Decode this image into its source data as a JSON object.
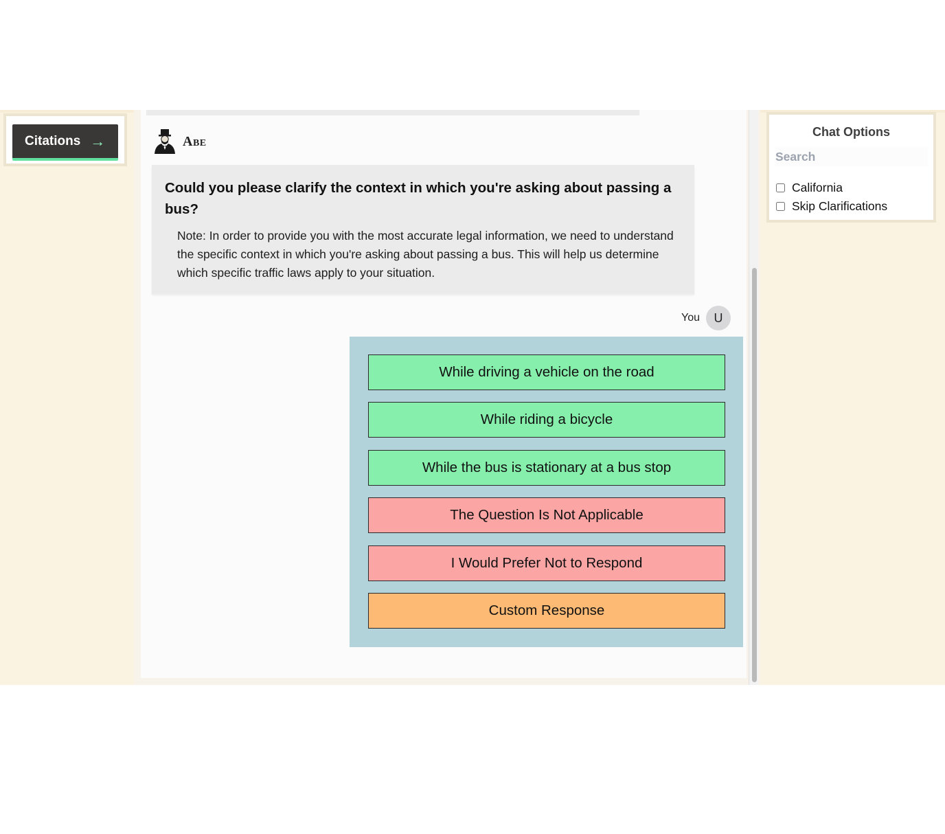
{
  "left_panel": {
    "citations_label": "Citations",
    "citations_icon": "arrow-right-icon"
  },
  "chat": {
    "bot_name": "Abe",
    "bot_avatar_icon": "lincoln-portrait-icon",
    "bot_question": "Could you please clarify the context in which you're asking about passing a bus?",
    "bot_note": "Note: In order to provide you with the most accurate legal information, we need to understand the specific context in which you're asking about passing a bus. This will help us determine which specific traffic laws apply to your situation.",
    "user_label": "You",
    "user_initial": "U",
    "options": [
      {
        "label": "While driving a vehicle on the road",
        "color": "#86efac"
      },
      {
        "label": "While riding a bicycle",
        "color": "#86efac"
      },
      {
        "label": "While the bus is stationary at a bus stop",
        "color": "#86efac"
      },
      {
        "label": "The Question Is Not Applicable",
        "color": "#fca5a5"
      },
      {
        "label": "I Would Prefer Not to Respond",
        "color": "#fca5a5"
      },
      {
        "label": "Custom Response",
        "color": "#fdba74"
      }
    ]
  },
  "chat_options": {
    "title": "Chat Options",
    "search_placeholder": "Search",
    "checkboxes": [
      {
        "label": "California",
        "checked": false
      },
      {
        "label": "Skip Clarifications",
        "checked": false
      }
    ]
  },
  "colors": {
    "background": "#faf3e2",
    "citations_button": "#3a3836",
    "citations_accent": "#62e0a0",
    "options_box": "#b2d3da"
  }
}
